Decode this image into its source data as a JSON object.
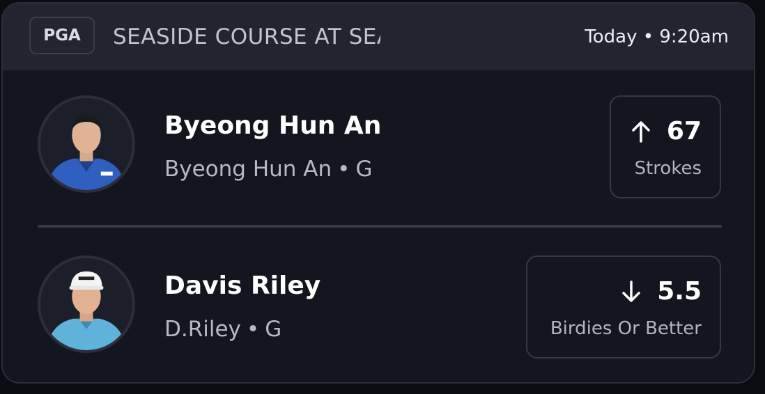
{
  "header": {
    "league": "PGA",
    "event_title": "SEASIDE COURSE AT SEA ISLAND",
    "time": "Today • 9:20am"
  },
  "players": [
    {
      "name": "Byeong Hun An",
      "short_name": "Byeong Hun An",
      "position": "G",
      "direction": "up",
      "value": "67",
      "stat": "Strokes",
      "shirt_color": "#2f5fbf"
    },
    {
      "name": "Davis Riley",
      "short_name": "D.Riley",
      "position": "G",
      "direction": "down",
      "value": "5.5",
      "stat": "Birdies Or Better",
      "shirt_color": "#5fb2d9"
    }
  ],
  "separator": "•"
}
